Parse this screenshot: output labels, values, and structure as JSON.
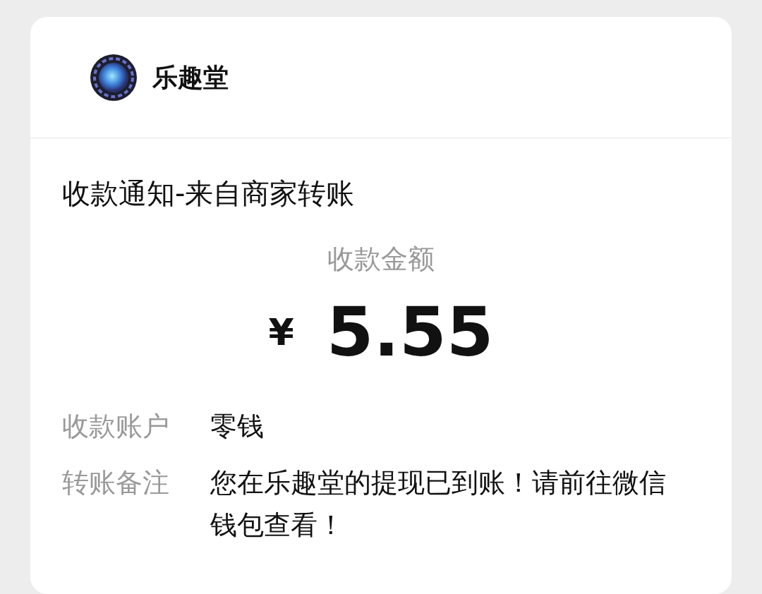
{
  "app": {
    "name": "乐趣堂"
  },
  "notice": {
    "title": "收款通知-来自商家转账",
    "amount_label": "收款金额",
    "currency": "¥",
    "amount": "5.55",
    "rows": [
      {
        "label": "收款账户",
        "value": "零钱"
      },
      {
        "label": "转账备注",
        "value": "您在乐趣堂的提现已到账！请前往微信钱包查看！"
      }
    ]
  }
}
